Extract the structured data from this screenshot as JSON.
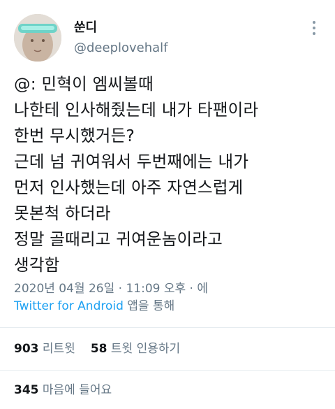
{
  "author": {
    "display_name": "쑨디",
    "handle": "@deeplovehalf"
  },
  "tweet": {
    "lines": [
      "@: 민혁이 엠씨볼때",
      "나한테 인사해줬는데 내가 타팬이라",
      "한번 무시했거든?",
      "근데 넘 귀여워서 두번째에는 내가",
      "먼저 인사했는데 아주 자연스럽게",
      "못본척 하더라",
      "정말 골때리고 귀여운놈이라고",
      "생각함"
    ]
  },
  "meta": {
    "timestamp": "2020년 04월 26일 · 11:09 오후 · 에",
    "source": "Twitter for Android",
    "source_suffix": " 앱을 통해"
  },
  "stats": {
    "retweets_count": "903",
    "retweets_label": "리트윗",
    "quotes_count": "58",
    "quotes_label": "트윗 인용하기",
    "likes_count": "345",
    "likes_label": "마음에 들어요"
  },
  "icons": {
    "more": "more-vertical-icon"
  },
  "colors": {
    "link": "#1da1f2",
    "muted": "#657786",
    "text": "#14171a",
    "divider": "#e6ecf0"
  }
}
